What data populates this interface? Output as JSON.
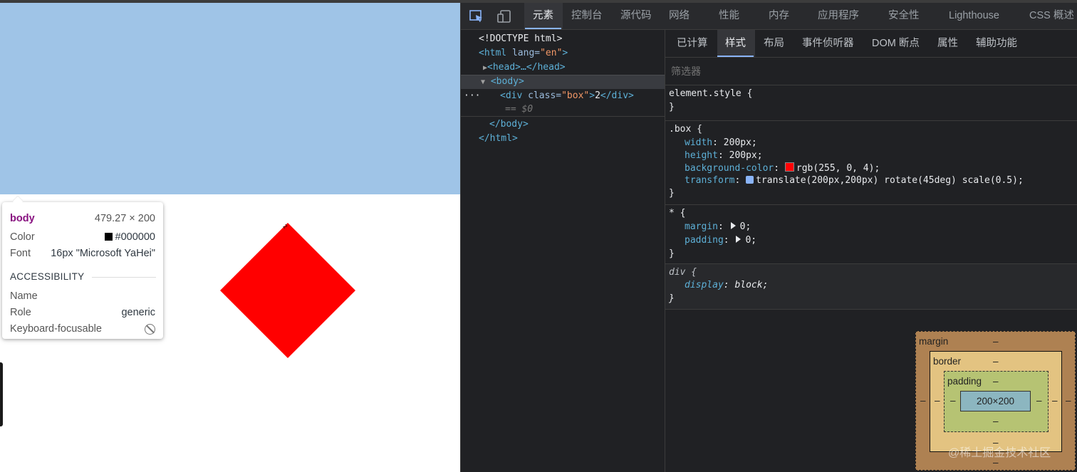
{
  "viewport": {
    "box_text": "2",
    "colors": {
      "highlight": "#9fc4e7",
      "box": "#ff0000"
    }
  },
  "tooltip": {
    "tag": "body",
    "dimensions": "479.27 × 200",
    "color_label": "Color",
    "color_value": "#000000",
    "font_label": "Font",
    "font_value": "16px \"Microsoft YaHei\"",
    "accessibility_heading": "ACCESSIBILITY",
    "name_label": "Name",
    "name_value": "",
    "role_label": "Role",
    "role_value": "generic",
    "focusable_label": "Keyboard-focusable"
  },
  "devtools": {
    "tabs": [
      "元素",
      "控制台",
      "源代码",
      "网络",
      "性能",
      "内存",
      "应用程序",
      "安全性",
      "Lighthouse",
      "CSS 概述 ⚠"
    ],
    "active_tab": "元素",
    "tree": {
      "doctype": "<!DOCTYPE html>",
      "html_open": "<html",
      "html_attr": " lang=",
      "html_attr_val": "\"en\"",
      "html_close_bracket": ">",
      "head": "<head>…</head>",
      "body_open": "<body>",
      "div_open": "<div",
      "div_attr": " class=",
      "div_attr_val": "\"box\"",
      "div_gt": ">",
      "div_text": "2",
      "div_close": "</div>",
      "dollar0": "== $0",
      "dots": "···",
      "body_close": "</body>",
      "html_end": "</html>"
    },
    "subtabs": [
      "已计算",
      "样式",
      "布局",
      "事件侦听器",
      "DOM 断点",
      "属性",
      "辅助功能"
    ],
    "active_subtab": "样式",
    "filter_placeholder": "筛选器",
    "rules": [
      {
        "selector": "element.style {",
        "close": "}",
        "props": []
      },
      {
        "selector": ".box {",
        "close": "}",
        "props": [
          {
            "name": "width",
            "value": "200px;"
          },
          {
            "name": "height",
            "value": "200px;"
          },
          {
            "name": "background-color",
            "value": "rgb(255, 0, 4);"
          },
          {
            "name": "transform",
            "value": "translate(200px,200px) rotate(45deg) scale(0.5);"
          }
        ]
      },
      {
        "selector": "* {",
        "close": "}",
        "props": [
          {
            "name": "margin",
            "value": "0;"
          },
          {
            "name": "padding",
            "value": "0;"
          }
        ]
      },
      {
        "selector": "div {",
        "close": "}",
        "props": [
          {
            "name": "display",
            "value": "block;"
          }
        ]
      }
    ],
    "box_model": {
      "margin_label": "margin",
      "border_label": "border",
      "padding_label": "padding",
      "content_size": "200×200",
      "dash": "–"
    },
    "watermark": "@稀土掘金技术社区"
  }
}
